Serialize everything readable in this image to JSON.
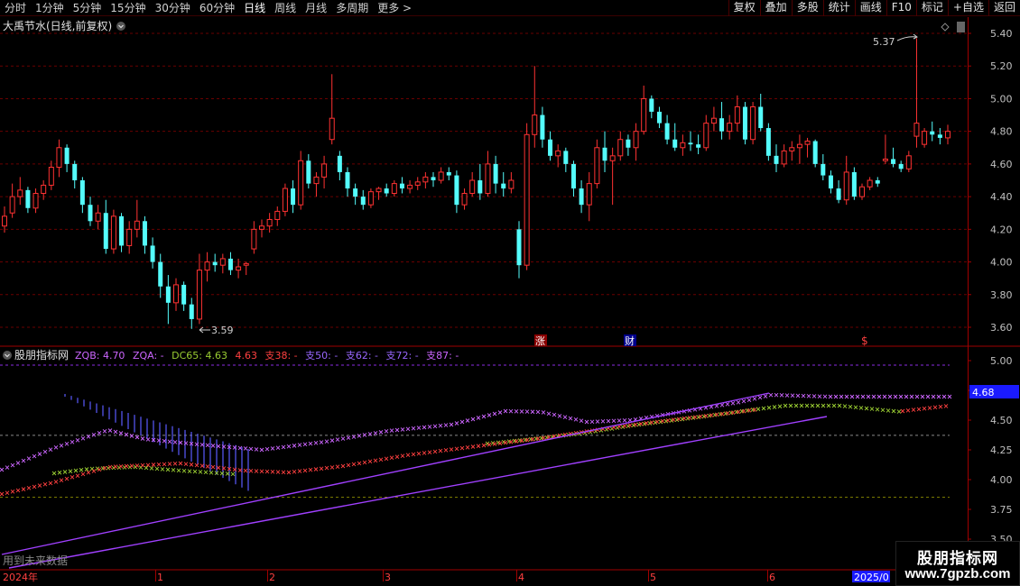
{
  "toolbar": {
    "periods": [
      "分时",
      "1分钟",
      "5分钟",
      "15分钟",
      "30分钟",
      "60分钟",
      "日线",
      "周线",
      "月线",
      "多周期",
      "更多 >"
    ],
    "active_period": "日线",
    "buttons": [
      "复权",
      "叠加",
      "多股",
      "统计",
      "画线",
      "F10",
      "标记",
      "+自选",
      "返回"
    ]
  },
  "main_panel": {
    "title": "大禹节水(日线,前复权)",
    "high_annotation": "5.37",
    "low_annotation": "3.59",
    "event_markers": [
      "涨",
      "财",
      "$"
    ],
    "price_axis": [
      "5.40",
      "5.20",
      "5.00",
      "4.80",
      "4.60",
      "4.40",
      "4.20",
      "4.00",
      "3.80",
      "3.60"
    ]
  },
  "indicator_panel": {
    "name": "股朋指标网",
    "legend": [
      {
        "text": "ZQB: 4.70",
        "color": "#cc66ff"
      },
      {
        "text": "ZQA: -",
        "color": "#cc66ff"
      },
      {
        "text": "DC65: 4.63",
        "color": "#9acd32"
      },
      {
        "text": "4.63",
        "color": "#ff4040"
      },
      {
        "text": "支38: -",
        "color": "#ff4040"
      },
      {
        "text": "支50: -",
        "color": "#9966ff"
      },
      {
        "text": "支62: -",
        "color": "#9966ff"
      },
      {
        "text": "支72: -",
        "color": "#9966ff"
      },
      {
        "text": "支87: -",
        "color": "#cc66ff"
      }
    ],
    "axis": [
      "5.00",
      "4.75",
      "4.50",
      "4.25",
      "4.00",
      "3.75",
      "3.50"
    ],
    "current_value": "4.68",
    "footer_note": "用到未来数据"
  },
  "time_axis": [
    "2024年",
    "1",
    "2",
    "3",
    "4",
    "5",
    "6",
    "2025/0"
  ],
  "watermark": {
    "title": "股朋指标网",
    "url": "www.7gpzb.com"
  },
  "colors": {
    "up": "#ff3232",
    "down": "#54fcfc",
    "axis": "#a00000",
    "grid": "#7a0000",
    "text": "#c0c0c0"
  },
  "chart_data": {
    "type": "candlestick",
    "title": "大禹节水(日线,前复权)",
    "ylim": [
      3.55,
      5.45
    ],
    "annotations": [
      {
        "text": "5.37",
        "value": 5.37
      },
      {
        "text": "3.59",
        "value": 3.59
      }
    ],
    "candles": [
      [
        4.22,
        4.34,
        4.18,
        4.28
      ],
      [
        4.3,
        4.48,
        4.27,
        4.4
      ],
      [
        4.4,
        4.52,
        4.35,
        4.44
      ],
      [
        4.44,
        4.46,
        4.3,
        4.33
      ],
      [
        4.33,
        4.45,
        4.3,
        4.42
      ],
      [
        4.42,
        4.5,
        4.38,
        4.47
      ],
      [
        4.47,
        4.62,
        4.44,
        4.58
      ],
      [
        4.58,
        4.75,
        4.52,
        4.7
      ],
      [
        4.7,
        4.72,
        4.55,
        4.6
      ],
      [
        4.6,
        4.62,
        4.45,
        4.5
      ],
      [
        4.5,
        4.52,
        4.3,
        4.35
      ],
      [
        4.35,
        4.4,
        4.22,
        4.25
      ],
      [
        4.25,
        4.35,
        4.2,
        4.3
      ],
      [
        4.3,
        4.38,
        4.05,
        4.08
      ],
      [
        4.08,
        4.32,
        4.05,
        4.28
      ],
      [
        4.28,
        4.3,
        4.06,
        4.1
      ],
      [
        4.1,
        4.25,
        4.05,
        4.2
      ],
      [
        4.2,
        4.38,
        4.15,
        4.25
      ],
      [
        4.25,
        4.28,
        4.05,
        4.1
      ],
      [
        4.1,
        4.15,
        3.96,
        4.0
      ],
      [
        4.0,
        4.05,
        3.78,
        3.85
      ],
      [
        3.85,
        3.92,
        3.62,
        3.75
      ],
      [
        3.75,
        3.9,
        3.7,
        3.86
      ],
      [
        3.86,
        3.88,
        3.7,
        3.74
      ],
      [
        3.74,
        3.78,
        3.59,
        3.65
      ],
      [
        3.65,
        4.05,
        3.62,
        3.95
      ],
      [
        3.95,
        4.06,
        3.88,
        4.0
      ],
      [
        4.0,
        4.05,
        3.94,
        3.98
      ],
      [
        3.98,
        4.05,
        3.93,
        4.02
      ],
      [
        4.02,
        4.06,
        3.92,
        3.95
      ],
      [
        3.95,
        4.02,
        3.9,
        3.97
      ],
      [
        3.98,
        4.0,
        3.92,
        3.99
      ],
      [
        4.08,
        4.25,
        4.05,
        4.2
      ],
      [
        4.2,
        4.26,
        4.15,
        4.22
      ],
      [
        4.22,
        4.3,
        4.18,
        4.26
      ],
      [
        4.26,
        4.34,
        4.22,
        4.31
      ],
      [
        4.31,
        4.48,
        4.28,
        4.45
      ],
      [
        4.45,
        4.5,
        4.3,
        4.35
      ],
      [
        4.35,
        4.68,
        4.32,
        4.62
      ],
      [
        4.62,
        4.66,
        4.45,
        4.48
      ],
      [
        4.48,
        4.55,
        4.4,
        4.52
      ],
      [
        4.52,
        4.65,
        4.45,
        4.6
      ],
      [
        4.75,
        5.15,
        4.72,
        4.88
      ],
      [
        4.65,
        4.68,
        4.5,
        4.55
      ],
      [
        4.55,
        4.58,
        4.4,
        4.45
      ],
      [
        4.45,
        4.48,
        4.35,
        4.4
      ],
      [
        4.4,
        4.44,
        4.32,
        4.35
      ],
      [
        4.35,
        4.45,
        4.33,
        4.43
      ],
      [
        4.43,
        4.46,
        4.38,
        4.45
      ],
      [
        4.45,
        4.48,
        4.4,
        4.42
      ],
      [
        4.42,
        4.5,
        4.4,
        4.48
      ],
      [
        4.48,
        4.52,
        4.42,
        4.45
      ],
      [
        4.45,
        4.5,
        4.42,
        4.47
      ],
      [
        4.47,
        4.52,
        4.44,
        4.49
      ],
      [
        4.49,
        4.55,
        4.45,
        4.52
      ],
      [
        4.52,
        4.55,
        4.46,
        4.5
      ],
      [
        4.5,
        4.58,
        4.48,
        4.55
      ],
      [
        4.55,
        4.58,
        4.5,
        4.53
      ],
      [
        4.53,
        4.56,
        4.3,
        4.35
      ],
      [
        4.35,
        4.45,
        4.32,
        4.42
      ],
      [
        4.42,
        4.55,
        4.4,
        4.5
      ],
      [
        4.5,
        4.6,
        4.38,
        4.42
      ],
      [
        4.42,
        4.68,
        4.4,
        4.6
      ],
      [
        4.6,
        4.65,
        4.42,
        4.48
      ],
      [
        4.48,
        4.55,
        4.4,
        4.45
      ],
      [
        4.45,
        4.55,
        4.42,
        4.5
      ],
      [
        4.2,
        4.25,
        3.9,
        3.98
      ],
      [
        3.98,
        4.85,
        3.95,
        4.78
      ],
      [
        4.78,
        5.2,
        4.7,
        4.9
      ],
      [
        4.9,
        4.95,
        4.7,
        4.75
      ],
      [
        4.75,
        4.8,
        4.62,
        4.65
      ],
      [
        4.65,
        4.72,
        4.58,
        4.68
      ],
      [
        4.68,
        4.7,
        4.55,
        4.6
      ],
      [
        4.6,
        4.62,
        4.4,
        4.45
      ],
      [
        4.45,
        4.5,
        4.3,
        4.35
      ],
      [
        4.35,
        4.55,
        4.25,
        4.48
      ],
      [
        4.48,
        4.75,
        4.45,
        4.7
      ],
      [
        4.7,
        4.8,
        4.55,
        4.62
      ],
      [
        4.62,
        4.7,
        4.35,
        4.65
      ],
      [
        4.65,
        4.8,
        4.62,
        4.75
      ],
      [
        4.75,
        4.78,
        4.65,
        4.7
      ],
      [
        4.7,
        4.85,
        4.62,
        4.8
      ],
      [
        4.8,
        5.08,
        4.78,
        5.0
      ],
      [
        5.0,
        5.02,
        4.88,
        4.92
      ],
      [
        4.92,
        4.95,
        4.82,
        4.85
      ],
      [
        4.85,
        4.9,
        4.72,
        4.75
      ],
      [
        4.75,
        4.85,
        4.68,
        4.7
      ],
      [
        4.7,
        4.78,
        4.65,
        4.73
      ],
      [
        4.73,
        4.8,
        4.68,
        4.72
      ],
      [
        4.72,
        4.78,
        4.66,
        4.7
      ],
      [
        4.7,
        4.9,
        4.68,
        4.85
      ],
      [
        4.85,
        4.95,
        4.8,
        4.88
      ],
      [
        4.88,
        4.98,
        4.75,
        4.8
      ],
      [
        4.8,
        4.9,
        4.75,
        4.85
      ],
      [
        4.85,
        5.02,
        4.8,
        4.95
      ],
      [
        4.95,
        4.98,
        4.72,
        4.75
      ],
      [
        4.75,
        4.98,
        4.72,
        4.95
      ],
      [
        4.95,
        5.03,
        4.8,
        4.82
      ],
      [
        4.82,
        4.85,
        4.62,
        4.65
      ],
      [
        4.65,
        4.72,
        4.55,
        4.6
      ],
      [
        4.6,
        4.72,
        4.58,
        4.68
      ],
      [
        4.68,
        4.74,
        4.62,
        4.7
      ],
      [
        4.7,
        4.78,
        4.6,
        4.72
      ],
      [
        4.72,
        4.76,
        4.64,
        4.74
      ],
      [
        4.74,
        4.75,
        4.58,
        4.6
      ],
      [
        4.6,
        4.66,
        4.5,
        4.53
      ],
      [
        4.53,
        4.56,
        4.42,
        4.45
      ],
      [
        4.45,
        4.5,
        4.36,
        4.38
      ],
      [
        4.38,
        4.65,
        4.35,
        4.55
      ],
      [
        4.55,
        4.58,
        4.38,
        4.4
      ],
      [
        4.4,
        4.48,
        4.38,
        4.46
      ],
      [
        4.46,
        4.52,
        4.44,
        4.5
      ],
      [
        4.5,
        4.52,
        4.46,
        4.48
      ],
      [
        4.62,
        4.78,
        4.6,
        4.63
      ],
      [
        4.63,
        4.7,
        4.58,
        4.6
      ],
      [
        4.6,
        4.62,
        4.55,
        4.57
      ],
      [
        4.57,
        4.68,
        4.55,
        4.65
      ],
      [
        4.77,
        5.37,
        4.7,
        4.85
      ],
      [
        4.72,
        4.82,
        4.7,
        4.8
      ],
      [
        4.8,
        4.86,
        4.74,
        4.78
      ],
      [
        4.78,
        4.82,
        4.72,
        4.76
      ],
      [
        4.76,
        4.84,
        4.72,
        4.8
      ]
    ]
  }
}
